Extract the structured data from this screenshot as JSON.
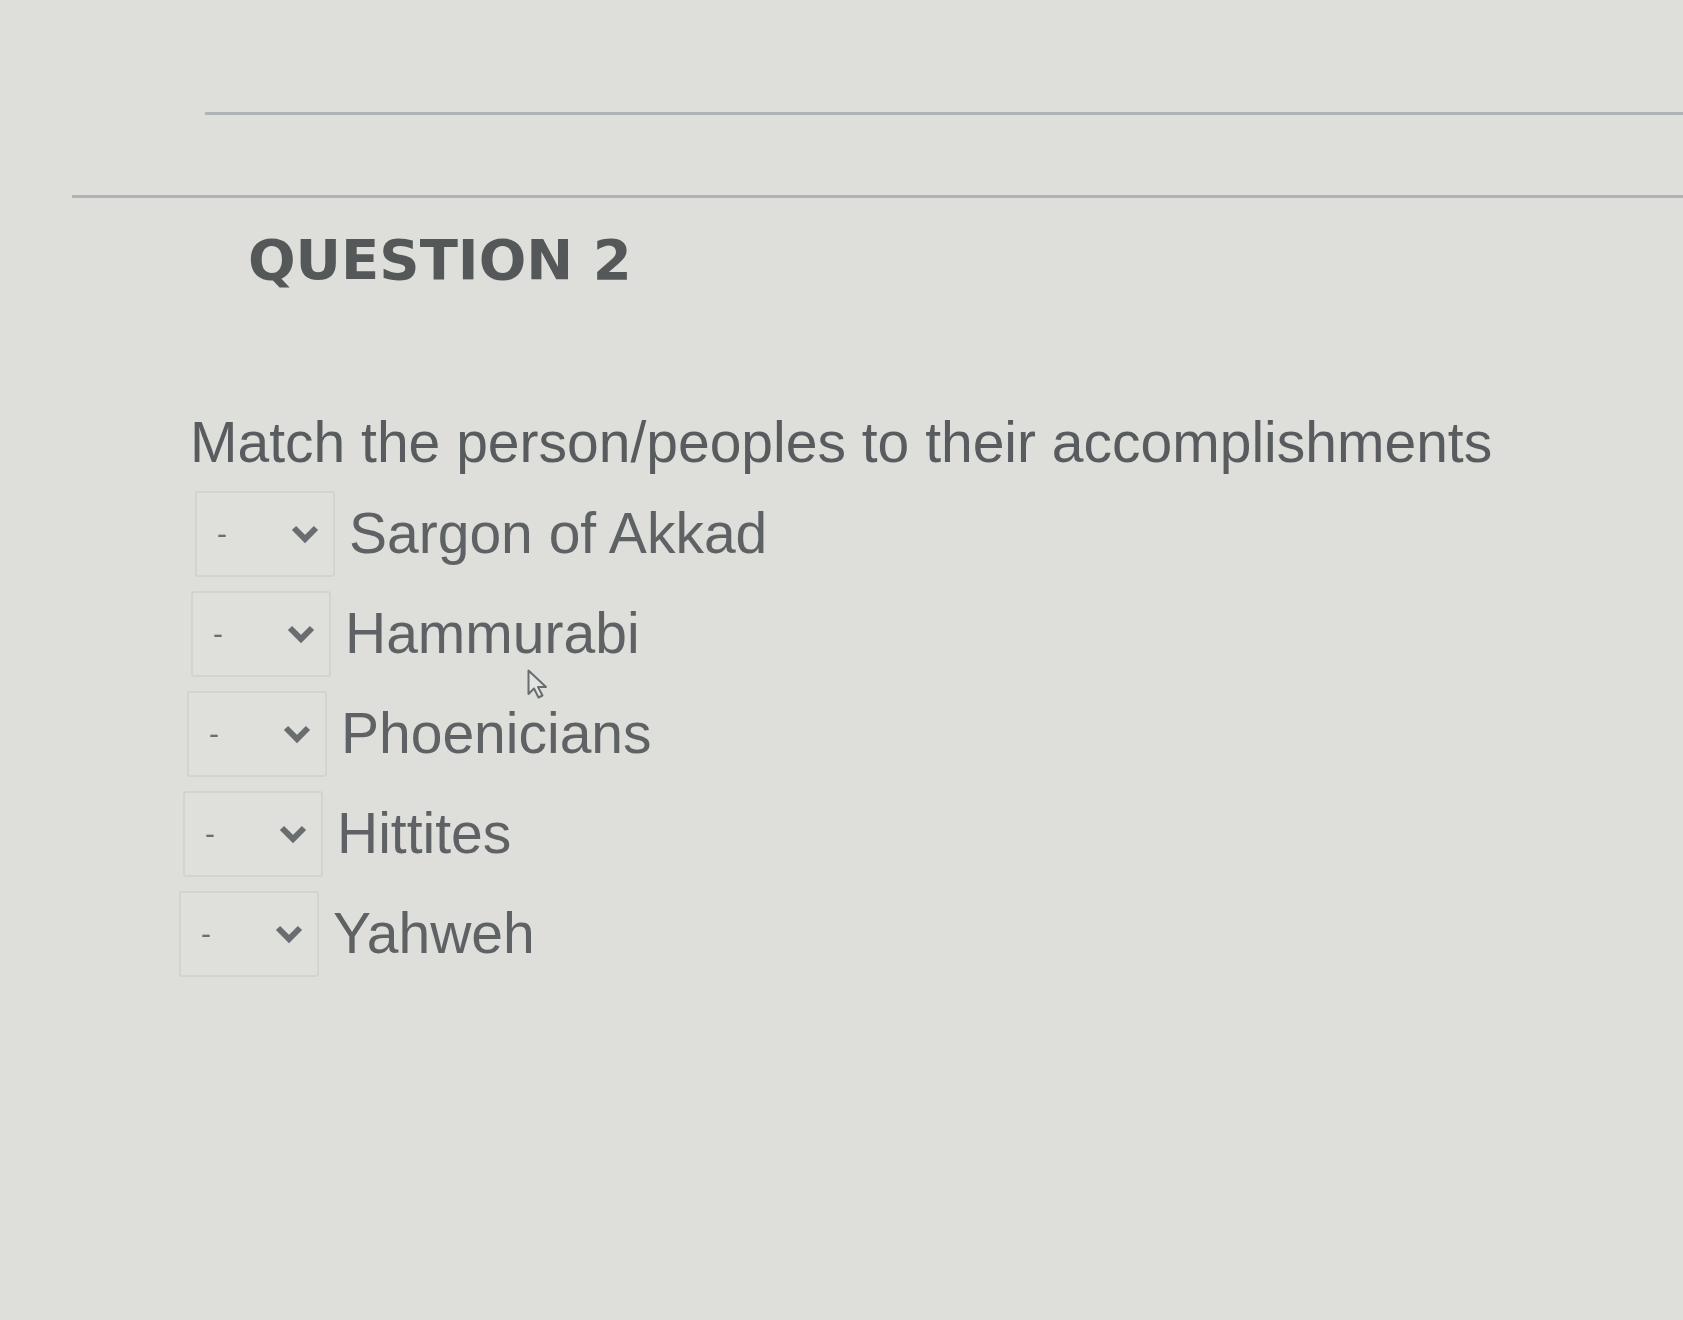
{
  "question": {
    "title": "QUESTION 2",
    "prompt": "Match the person/peoples to their accomplishments"
  },
  "matches": [
    {
      "value": "-",
      "label": "Sargon of Akkad"
    },
    {
      "value": "-",
      "label": "Hammurabi"
    },
    {
      "value": "-",
      "label": "Phoenicians"
    },
    {
      "value": "-",
      "label": "Hittites"
    },
    {
      "value": "-",
      "label": "Yahweh"
    }
  ]
}
